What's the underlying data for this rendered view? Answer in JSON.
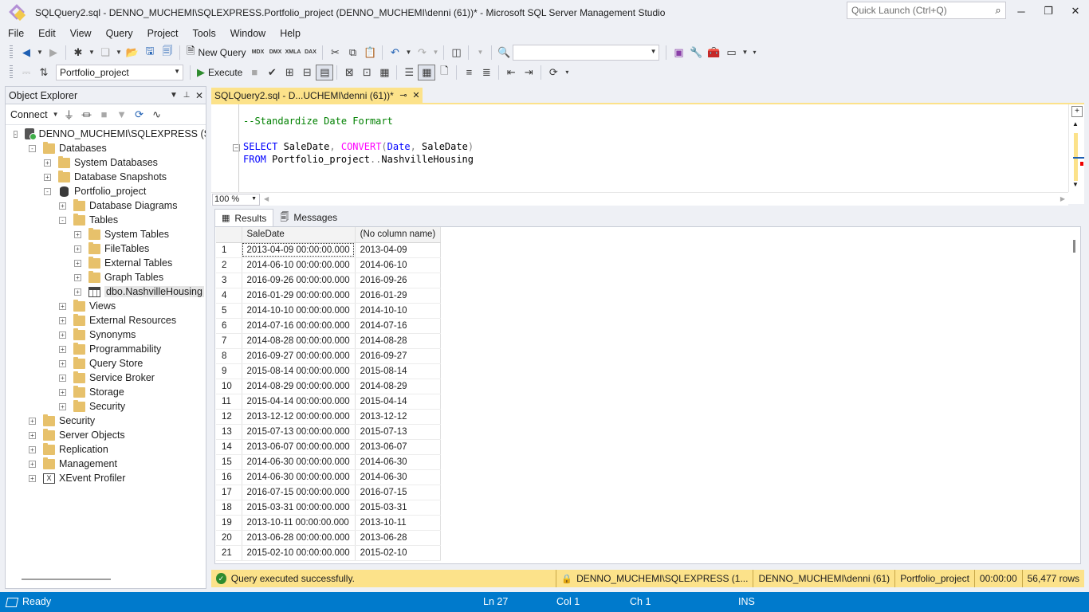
{
  "window": {
    "title": "SQLQuery2.sql - DENNO_MUCHEMI\\SQLEXPRESS.Portfolio_project (DENNO_MUCHEMI\\denni (61))* - Microsoft SQL Server Management Studio",
    "quick_launch_placeholder": "Quick Launch (Ctrl+Q)"
  },
  "menu": [
    "File",
    "Edit",
    "View",
    "Query",
    "Project",
    "Tools",
    "Window",
    "Help"
  ],
  "toolbar": {
    "new_query_label": "New Query",
    "database_selected": "Portfolio_project",
    "execute_label": "Execute",
    "mdx": "MDX",
    "dmx": "DMX",
    "xmla": "XMLA",
    "dax": "DAX"
  },
  "object_explorer": {
    "title": "Object Explorer",
    "connect_label": "Connect",
    "tree": [
      {
        "label": "DENNO_MUCHEMI\\SQLEXPRESS (SQL",
        "level": 0,
        "toggle": "-",
        "icon": "server"
      },
      {
        "label": "Databases",
        "level": 1,
        "toggle": "-",
        "icon": "folder"
      },
      {
        "label": "System Databases",
        "level": 2,
        "toggle": "+",
        "icon": "folder"
      },
      {
        "label": "Database Snapshots",
        "level": 2,
        "toggle": "+",
        "icon": "folder"
      },
      {
        "label": "Portfolio_project",
        "level": 2,
        "toggle": "-",
        "icon": "database"
      },
      {
        "label": "Database Diagrams",
        "level": 3,
        "toggle": "+",
        "icon": "folder"
      },
      {
        "label": "Tables",
        "level": 3,
        "toggle": "-",
        "icon": "folder"
      },
      {
        "label": "System Tables",
        "level": 4,
        "toggle": "+",
        "icon": "folder"
      },
      {
        "label": "FileTables",
        "level": 4,
        "toggle": "+",
        "icon": "folder"
      },
      {
        "label": "External Tables",
        "level": 4,
        "toggle": "+",
        "icon": "folder"
      },
      {
        "label": "Graph Tables",
        "level": 4,
        "toggle": "+",
        "icon": "folder"
      },
      {
        "label": "dbo.NashvilleHousing",
        "level": 4,
        "toggle": "+",
        "icon": "table",
        "selected": true
      },
      {
        "label": "Views",
        "level": 3,
        "toggle": "+",
        "icon": "folder"
      },
      {
        "label": "External Resources",
        "level": 3,
        "toggle": "+",
        "icon": "folder"
      },
      {
        "label": "Synonyms",
        "level": 3,
        "toggle": "+",
        "icon": "folder"
      },
      {
        "label": "Programmability",
        "level": 3,
        "toggle": "+",
        "icon": "folder"
      },
      {
        "label": "Query Store",
        "level": 3,
        "toggle": "+",
        "icon": "folder"
      },
      {
        "label": "Service Broker",
        "level": 3,
        "toggle": "+",
        "icon": "folder"
      },
      {
        "label": "Storage",
        "level": 3,
        "toggle": "+",
        "icon": "folder"
      },
      {
        "label": "Security",
        "level": 3,
        "toggle": "+",
        "icon": "folder"
      },
      {
        "label": "Security",
        "level": 1,
        "toggle": "+",
        "icon": "folder"
      },
      {
        "label": "Server Objects",
        "level": 1,
        "toggle": "+",
        "icon": "folder"
      },
      {
        "label": "Replication",
        "level": 1,
        "toggle": "+",
        "icon": "folder"
      },
      {
        "label": "Management",
        "level": 1,
        "toggle": "+",
        "icon": "folder"
      },
      {
        "label": "XEvent Profiler",
        "level": 1,
        "toggle": "+",
        "icon": "xevent"
      }
    ]
  },
  "editor": {
    "tab_label": "SQLQuery2.sql - D...UCHEMI\\denni (61))*",
    "zoom": "100 %",
    "code": {
      "comment": "--Standardize Date Formart",
      "select_kw": "SELECT",
      "select_col": " SaleDate",
      "comma1": ",",
      "convert_fn": " CONVERT",
      "paren_open": "(",
      "date_kw": "Date",
      "comma2": ",",
      "arg2": " SaleDate",
      "paren_close": ")",
      "from_kw": "FROM",
      "from_db": " Portfolio_project",
      "dots": "..",
      "from_table": "NashvilleHousing"
    }
  },
  "results": {
    "tabs": {
      "results": "Results",
      "messages": "Messages"
    },
    "columns": [
      "SaleDate",
      "(No column name)"
    ],
    "rows": [
      [
        "1",
        "2013-04-09 00:00:00.000",
        "2013-04-09"
      ],
      [
        "2",
        "2014-06-10 00:00:00.000",
        "2014-06-10"
      ],
      [
        "3",
        "2016-09-26 00:00:00.000",
        "2016-09-26"
      ],
      [
        "4",
        "2016-01-29 00:00:00.000",
        "2016-01-29"
      ],
      [
        "5",
        "2014-10-10 00:00:00.000",
        "2014-10-10"
      ],
      [
        "6",
        "2014-07-16 00:00:00.000",
        "2014-07-16"
      ],
      [
        "7",
        "2014-08-28 00:00:00.000",
        "2014-08-28"
      ],
      [
        "8",
        "2016-09-27 00:00:00.000",
        "2016-09-27"
      ],
      [
        "9",
        "2015-08-14 00:00:00.000",
        "2015-08-14"
      ],
      [
        "10",
        "2014-08-29 00:00:00.000",
        "2014-08-29"
      ],
      [
        "11",
        "2015-04-14 00:00:00.000",
        "2015-04-14"
      ],
      [
        "12",
        "2013-12-12 00:00:00.000",
        "2013-12-12"
      ],
      [
        "13",
        "2015-07-13 00:00:00.000",
        "2015-07-13"
      ],
      [
        "14",
        "2013-06-07 00:00:00.000",
        "2013-06-07"
      ],
      [
        "15",
        "2014-06-30 00:00:00.000",
        "2014-06-30"
      ],
      [
        "16",
        "2014-06-30 00:00:00.000",
        "2014-06-30"
      ],
      [
        "17",
        "2016-07-15 00:00:00.000",
        "2016-07-15"
      ],
      [
        "18",
        "2015-03-31 00:00:00.000",
        "2015-03-31"
      ],
      [
        "19",
        "2013-10-11 00:00:00.000",
        "2013-10-11"
      ],
      [
        "20",
        "2013-06-28 00:00:00.000",
        "2013-06-28"
      ],
      [
        "21",
        "2015-02-10 00:00:00.000",
        "2015-02-10"
      ]
    ]
  },
  "query_status": {
    "message": "Query executed successfully.",
    "server": "DENNO_MUCHEMI\\SQLEXPRESS (1...",
    "user": "DENNO_MUCHEMI\\denni (61)",
    "database": "Portfolio_project",
    "elapsed": "00:00:00",
    "rows": "56,477 rows"
  },
  "statusbar": {
    "ready": "Ready",
    "line": "Ln 27",
    "col": "Col 1",
    "ch": "Ch 1",
    "mode": "INS"
  },
  "colors": {
    "accent_blue": "#007acc",
    "tab_yellow": "#fce28a",
    "keyword": "#0000ff",
    "function": "#ff00ff",
    "comment": "#008000"
  }
}
